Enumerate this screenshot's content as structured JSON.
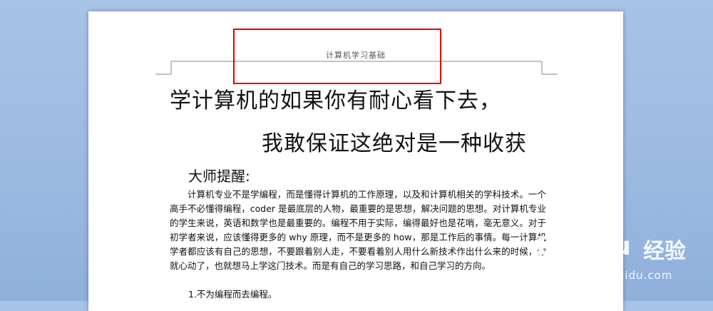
{
  "document": {
    "header": "计算机学习基础",
    "title_line1": "学计算机的如果你有耐心看下去，",
    "title_line2": "我敢保证这绝对是一种收获",
    "subheading": "大师提醒:",
    "paragraph": "计算机专业不是学编程，而是懂得计算机的工作原理，以及和计算机相关的学科技术。一个高手不必懂得编程，coder 是最底层的人物，最重要的是思想，解决问题的思想。对计算机专业的学生来说，英语和数学也是最重要的。编程不用于实际，编得最好也是花哨，毫无意义。对于初学者来说，应该懂得更多的 why 原理，而不是更多的 how，那是工作后的事情。每一计算机学者都应该有自己的思想，不要跟着别人走，不要看着别人用什么新技术作出什么来的时候，你就心动了，也就想马上学这门技术。而是有自己的学习思路，和自己学习的方向。",
    "list_item_1": "1.不为编程而去编程。"
  },
  "annotation": {
    "highlight_color": "#e50000"
  },
  "watermark": {
    "logo": "Bai du",
    "brand": "经验",
    "url": "jingyan.baidu.com"
  },
  "colors": {
    "background": "#9fbbe2",
    "page": "#ffffff",
    "text": "#111111"
  }
}
